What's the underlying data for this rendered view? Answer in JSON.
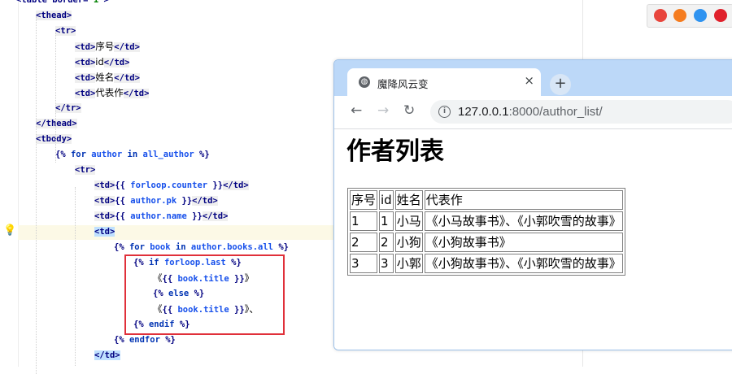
{
  "editor": {
    "lines": [
      {
        "segments": [
          {
            "t": "<table border=",
            "c": "tag"
          },
          {
            "t": "\"1\"",
            "c": "attrval"
          },
          {
            "t": ">",
            "c": "tag"
          }
        ]
      },
      {
        "segments": [
          {
            "t": "<thead>",
            "c": "tag tagbg"
          }
        ]
      },
      {
        "segments": [
          {
            "t": "<tr>",
            "c": "tag tagbg"
          }
        ]
      },
      {
        "segments": [
          {
            "t": "<td>",
            "c": "tag tagbg"
          },
          {
            "t": "序号",
            "c": "txt"
          },
          {
            "t": "</td>",
            "c": "tag tagbg"
          }
        ]
      },
      {
        "segments": [
          {
            "t": "<td>",
            "c": "tag tagbg"
          },
          {
            "t": "id",
            "c": "txt"
          },
          {
            "t": "</td>",
            "c": "tag tagbg"
          }
        ]
      },
      {
        "segments": [
          {
            "t": "<td>",
            "c": "tag tagbg"
          },
          {
            "t": "姓名",
            "c": "txt"
          },
          {
            "t": "</td>",
            "c": "tag tagbg"
          }
        ]
      },
      {
        "segments": [
          {
            "t": "<td>",
            "c": "tag tagbg"
          },
          {
            "t": "代表作",
            "c": "txt"
          },
          {
            "t": "</td>",
            "c": "tag tagbg"
          }
        ]
      },
      {
        "segments": [
          {
            "t": "</tr>",
            "c": "tag tagbg"
          }
        ]
      },
      {
        "segments": [
          {
            "t": "</thead>",
            "c": "tag tagbg"
          }
        ]
      },
      {
        "segments": [
          {
            "t": "<tbody>",
            "c": "tag tagbg"
          }
        ]
      },
      {
        "segments": [
          {
            "t": "{% ",
            "c": "tpl"
          },
          {
            "t": "for",
            "c": "tplkw"
          },
          {
            "t": " author ",
            "c": "tplvar"
          },
          {
            "t": "in",
            "c": "tplkw"
          },
          {
            "t": " all_author ",
            "c": "tplvar"
          },
          {
            "t": "%}",
            "c": "tpl"
          }
        ]
      },
      {
        "segments": [
          {
            "t": "<tr>",
            "c": "tag tagbg"
          }
        ]
      },
      {
        "segments": [
          {
            "t": "<td>",
            "c": "tag tagbg"
          },
          {
            "t": "{{ ",
            "c": "tpl"
          },
          {
            "t": "forloop.counter",
            "c": "tplvar"
          },
          {
            "t": " }}",
            "c": "tpl"
          },
          {
            "t": "</td>",
            "c": "tag tagbg"
          }
        ]
      },
      {
        "segments": [
          {
            "t": "<td>",
            "c": "tag tagbg"
          },
          {
            "t": "{{ ",
            "c": "tpl"
          },
          {
            "t": "author.pk",
            "c": "tplvar"
          },
          {
            "t": " }}",
            "c": "tpl"
          },
          {
            "t": "</td>",
            "c": "tag tagbg"
          }
        ]
      },
      {
        "segments": [
          {
            "t": "<td>",
            "c": "tag tagbg"
          },
          {
            "t": "{{ ",
            "c": "tpl"
          },
          {
            "t": "author.name",
            "c": "tplvar"
          },
          {
            "t": " }}",
            "c": "tpl"
          },
          {
            "t": "</td>",
            "c": "tag tagbg"
          }
        ]
      },
      {
        "segments": [
          {
            "t": "<td>",
            "c": "tag tagsel"
          }
        ]
      },
      {
        "segments": [
          {
            "t": "{% ",
            "c": "tpl"
          },
          {
            "t": "for",
            "c": "tplkw"
          },
          {
            "t": " book ",
            "c": "tplvar"
          },
          {
            "t": "in",
            "c": "tplkw"
          },
          {
            "t": " author.books.all ",
            "c": "tplvar"
          },
          {
            "t": "%}",
            "c": "tpl"
          }
        ]
      },
      {
        "segments": [
          {
            "t": "{% ",
            "c": "tpl"
          },
          {
            "t": "if",
            "c": "tplkw"
          },
          {
            "t": " forloop.last ",
            "c": "tplvar"
          },
          {
            "t": "%}",
            "c": "tpl"
          }
        ]
      },
      {
        "segments": [
          {
            "t": "《",
            "c": "txt"
          },
          {
            "t": "{{ ",
            "c": "tpl"
          },
          {
            "t": "book.title",
            "c": "tplvar"
          },
          {
            "t": " }}",
            "c": "tpl"
          },
          {
            "t": "》",
            "c": "txt"
          }
        ]
      },
      {
        "segments": [
          {
            "t": "{% ",
            "c": "tpl"
          },
          {
            "t": "else",
            "c": "tplkw"
          },
          {
            "t": " %}",
            "c": "tpl"
          }
        ]
      },
      {
        "segments": [
          {
            "t": "《",
            "c": "txt"
          },
          {
            "t": "{{ ",
            "c": "tpl"
          },
          {
            "t": "book.title",
            "c": "tplvar"
          },
          {
            "t": " }}",
            "c": "tpl"
          },
          {
            "t": "》、",
            "c": "txt"
          }
        ]
      },
      {
        "segments": [
          {
            "t": "{% ",
            "c": "tpl"
          },
          {
            "t": "endif",
            "c": "tplkw"
          },
          {
            "t": " %}",
            "c": "tpl"
          }
        ]
      },
      {
        "segments": [
          {
            "t": "{% ",
            "c": "tpl"
          },
          {
            "t": "endfor",
            "c": "tplkw"
          },
          {
            "t": " %}",
            "c": "tpl"
          }
        ]
      },
      {
        "segments": [
          {
            "t": "</td>",
            "c": "tag tagsel"
          }
        ]
      },
      {
        "segments": [
          {
            "t": "",
            "c": "tag"
          }
        ]
      }
    ]
  },
  "extensions": [
    {
      "icon": "chrome-icon",
      "color": "#e8453c"
    },
    {
      "icon": "firefox-icon",
      "color": "#f57c1f"
    },
    {
      "icon": "safari-icon",
      "color": "#2f93f0"
    },
    {
      "icon": "opera-icon",
      "color": "#e0202b"
    }
  ],
  "browser": {
    "tab_title": "魔降风云变",
    "tab_close": "×",
    "new_tab": "+",
    "back": "←",
    "forward": "→",
    "reload": "↻",
    "info": "i",
    "url_host": "127.0.0.1",
    "url_path": ":8000/author_list/",
    "page_heading": "作者列表",
    "table": {
      "headers": [
        "序号",
        "id",
        "姓名",
        "代表作"
      ],
      "rows": [
        [
          "1",
          "1",
          "小马",
          "《小马故事书》、《小郭吹雪的故事》"
        ],
        [
          "2",
          "2",
          "小狗",
          "《小狗故事书》"
        ],
        [
          "3",
          "3",
          "小郭",
          "《小狗故事书》、《小郭吹雪的故事》"
        ]
      ]
    }
  }
}
